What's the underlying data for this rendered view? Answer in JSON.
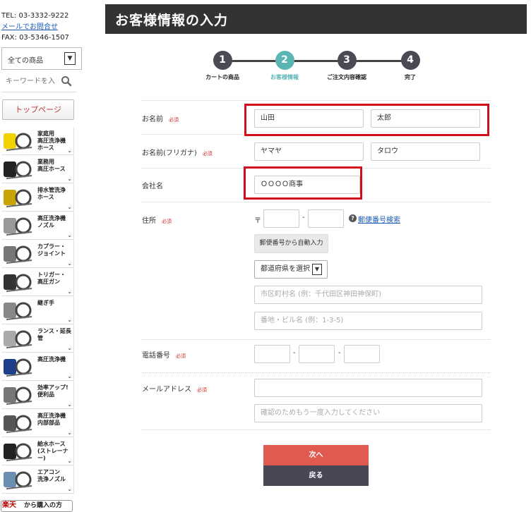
{
  "sidebar": {
    "tel": "TEL: 03-3332-9222",
    "mail_link": "メールでお問合せ",
    "fax": "FAX: 03-5346-1507",
    "category_select": "全ての商品",
    "search_placeholder": "キーワードを入",
    "top_button": "トップページ",
    "categories": [
      {
        "label": "家庭用\n高圧洗浄機\nホース",
        "icon": "hose-reel-icon"
      },
      {
        "label": "業務用\n高圧ホース",
        "icon": "hose-coil-icon"
      },
      {
        "label": "排水管洗浄\nホース",
        "icon": "drain-hose-icon"
      },
      {
        "label": "高圧洗浄機\nノズル",
        "icon": "nozzle-icon"
      },
      {
        "label": "カプラー・\nジョイント",
        "icon": "coupler-icon"
      },
      {
        "label": "トリガー・\n高圧ガン",
        "icon": "trigger-gun-icon"
      },
      {
        "label": "継ぎ手",
        "icon": "fitting-icon"
      },
      {
        "label": "ランス・延長管",
        "icon": "lance-icon"
      },
      {
        "label": "高圧洗浄機",
        "icon": "washer-machine-icon"
      },
      {
        "label": "効率アップ!\n便利品",
        "icon": "surface-cleaner-icon"
      },
      {
        "label": "高圧洗浄機\n内部部品",
        "icon": "pump-part-icon"
      },
      {
        "label": "給水ホース\n(ストレーナー)",
        "icon": "water-hose-icon"
      },
      {
        "label": "エアコン\n洗浄ノズル",
        "icon": "aircon-nozzle-icon"
      }
    ],
    "rakuten_logo": "楽天",
    "rakuten_text": "から購入の方"
  },
  "header": {
    "title": "お客様情報の入力"
  },
  "steps": [
    {
      "num": "1",
      "label": "カートの商品"
    },
    {
      "num": "2",
      "label": "お客様情報"
    },
    {
      "num": "3",
      "label": "ご注文内容確認"
    },
    {
      "num": "4",
      "label": "完了"
    }
  ],
  "form": {
    "required": "必須",
    "name": {
      "label": "お名前",
      "last": "山田",
      "first": "太郎"
    },
    "kana": {
      "label": "お名前(フリガナ)",
      "last": "ヤマヤ",
      "first": "タロウ"
    },
    "company": {
      "label": "会社名",
      "value": "ＯＯＯＯ商事"
    },
    "address": {
      "label": "住所",
      "zip_mark": "〒",
      "zip_search": "郵便番号検索",
      "auto_fill": "郵便番号から自動入力",
      "pref_select": "都道府県を選択",
      "city_placeholder": "市区町村名 (例：千代田区神田神保町)",
      "street_placeholder": "番地・ビル名 (例：1-3-5)"
    },
    "phone": {
      "label": "電話番号"
    },
    "email": {
      "label": "メールアドレス",
      "confirm_placeholder": "確認のためもう一度入力してください"
    }
  },
  "buttons": {
    "next": "次へ",
    "back": "戻る"
  },
  "colors": {
    "header_bg": "#333333",
    "active_step": "#5bb6b3",
    "highlight": "#d10f1a",
    "next_btn": "#e05a50",
    "back_btn": "#4a4655"
  }
}
